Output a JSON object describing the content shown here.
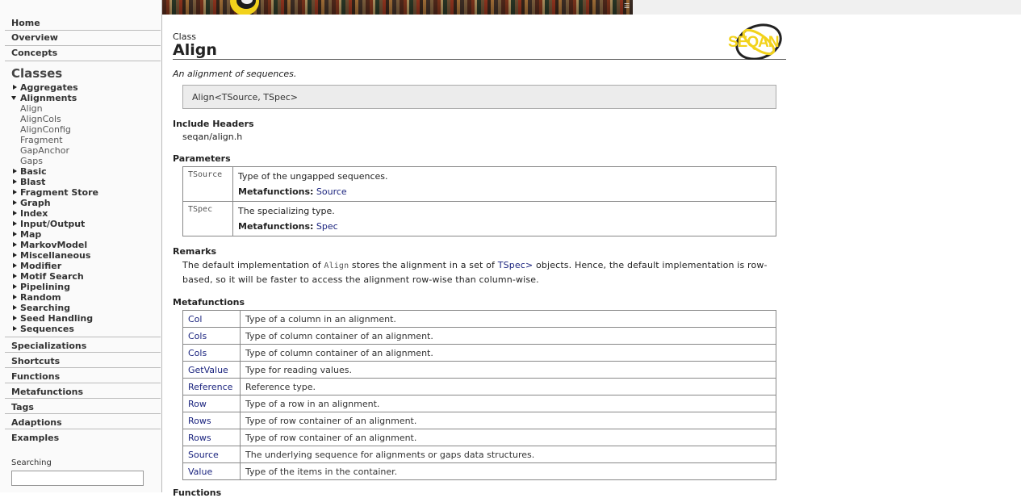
{
  "nav": {
    "home": "Home",
    "overview": "Overview",
    "concepts": "Concepts",
    "classes_heading": "Classes",
    "groups": [
      {
        "label": "Aggregates",
        "expanded": false
      },
      {
        "label": "Alignments",
        "expanded": true
      },
      {
        "label": "Basic",
        "expanded": false
      },
      {
        "label": "Blast",
        "expanded": false
      },
      {
        "label": "Fragment Store",
        "expanded": false
      },
      {
        "label": "Graph",
        "expanded": false
      },
      {
        "label": "Index",
        "expanded": false
      },
      {
        "label": "Input/Output",
        "expanded": false
      },
      {
        "label": "Map",
        "expanded": false
      },
      {
        "label": "MarkovModel",
        "expanded": false
      },
      {
        "label": "Miscellaneous",
        "expanded": false
      },
      {
        "label": "Modifier",
        "expanded": false
      },
      {
        "label": "Motif Search",
        "expanded": false
      },
      {
        "label": "Pipelining",
        "expanded": false
      },
      {
        "label": "Random",
        "expanded": false
      },
      {
        "label": "Searching",
        "expanded": false
      },
      {
        "label": "Seed Handling",
        "expanded": false
      },
      {
        "label": "Sequences",
        "expanded": false
      }
    ],
    "alignments_children": [
      "Align",
      "AlignCols",
      "AlignConfig",
      "Fragment",
      "GapAnchor",
      "Gaps"
    ],
    "specializations": "Specializations",
    "shortcuts": "Shortcuts",
    "functions": "Functions",
    "metafunctions": "Metafunctions",
    "tags": "Tags",
    "adaptions": "Adaptions",
    "examples": "Examples",
    "search_label": "Searching",
    "search_value": ""
  },
  "banner": {
    "menu_icon": "menu-icon"
  },
  "page": {
    "kind": "Class",
    "title": "Align",
    "logo_text": "SEQAN",
    "brief": "An alignment of sequences.",
    "signature": "Align<TSource, TSpec>",
    "include_heading": "Include Headers",
    "include_value": "seqan/align.h",
    "params_heading": "Parameters",
    "params": [
      {
        "name": "TSource",
        "desc": "Type of the ungapped sequences.",
        "mf_label": "Metafunctions:",
        "mf_link": "Source"
      },
      {
        "name": "TSpec",
        "desc": "The specializing type.",
        "mf_label": "Metafunctions:",
        "mf_link": "Spec"
      }
    ],
    "remarks_heading": "Remarks",
    "remarks": {
      "part1": "The default implementation of ",
      "code": "Align",
      "part2": " stores the alignment in a set of ",
      "link": "TSpec>",
      "part3": " objects. Hence, the default implementation is row-based, so it will be faster to access the alignment row-wise than column-wise."
    },
    "metafunctions_heading": "Metafunctions",
    "metafunctions": [
      {
        "name": "Col",
        "desc": "Type of a column in an alignment."
      },
      {
        "name": "Cols",
        "desc": "Type of column container of an alignment."
      },
      {
        "name": "Cols",
        "desc": "Type of column container of an alignment."
      },
      {
        "name": "GetValue",
        "desc": "Type for reading values."
      },
      {
        "name": "Reference",
        "desc": "Reference type."
      },
      {
        "name": "Row",
        "desc": "Type of a row in an alignment."
      },
      {
        "name": "Rows",
        "desc": "Type of row container of an alignment."
      },
      {
        "name": "Rows",
        "desc": "Type of row container of an alignment."
      },
      {
        "name": "Source",
        "desc": "The underlying sequence for alignments or gaps data structures."
      },
      {
        "name": "Value",
        "desc": "Type of the items in the container."
      }
    ],
    "functions_heading": "Functions"
  },
  "colors": {
    "link": "#1a237e",
    "logo_yellow": "#f2d21b",
    "signature_bg": "#ececec"
  }
}
